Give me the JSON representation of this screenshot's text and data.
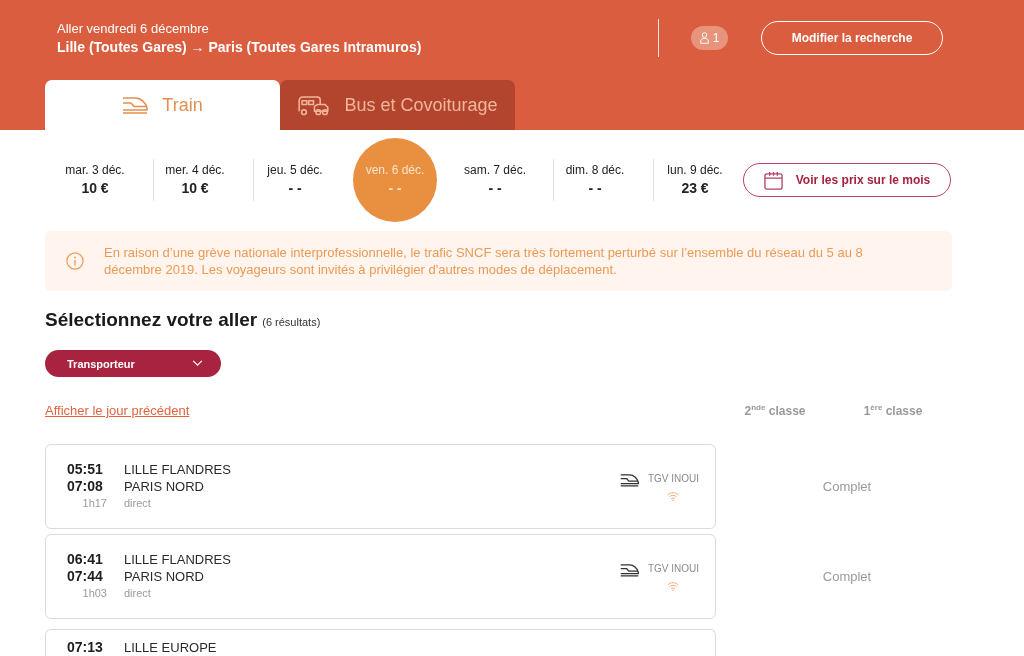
{
  "header": {
    "subtitle": "Aller vendredi 6 décembre",
    "route": "Lille (Toutes Gares) → Paris (Toutes Gares Intramuros)",
    "passengers": "1",
    "modify_button": "Modifier la recherche"
  },
  "tabs": [
    {
      "kind": "train",
      "label": "Train",
      "selected": true
    },
    {
      "kind": "bus",
      "label": "Bus et Covoiturage",
      "selected": false
    }
  ],
  "dates": [
    {
      "label": "mar. 3 déc.",
      "price": "10 €",
      "selected": false
    },
    {
      "label": "mer. 4 déc.",
      "price": "10 €",
      "selected": false
    },
    {
      "label": "jeu. 5 déc.",
      "price": "- -",
      "selected": false
    },
    {
      "label": "ven. 6 déc.",
      "price": "- -",
      "selected": true
    },
    {
      "label": "sam. 7 déc.",
      "price": "- -",
      "selected": false
    },
    {
      "label": "dim. 8 déc.",
      "price": "- -",
      "selected": false
    },
    {
      "label": "lun. 9 déc.",
      "price": "23 €",
      "selected": false
    }
  ],
  "month_prices_button": "Voir les prix sur le mois",
  "alert": {
    "text": "En raison d’une grève nationale interprofessionnelle, le trafic SNCF sera très fortement perturbé sur l’ensemble du réseau du 5 au 8 décembre 2019. Les voyageurs sont invités à privilégier d'autres modes de déplacement."
  },
  "results": {
    "title": "Sélectionnez votre aller",
    "count": "(6 résultats)",
    "filter": "Transporteur",
    "previous_day_link": "Afficher le jour précédent",
    "columns": [
      "2$^{nde}$ classe",
      "1$^{ère}$ classe"
    ],
    "rows": [
      {
        "departure": "05:51",
        "arrival": "07:08",
        "duration": "1h17",
        "origin": "LILLE FLANDRES",
        "destination": "PARIS NORD",
        "connection": "direct",
        "operator": "TGV INOUI",
        "wifi": true,
        "fare": "Complet"
      },
      {
        "departure": "06:41",
        "arrival": "07:44",
        "duration": "1h03",
        "origin": "LILLE FLANDRES",
        "destination": "PARIS NORD",
        "connection": "direct",
        "operator": "TGV INOUI",
        "wifi": true,
        "fare": "Complet"
      },
      {
        "departure": "07:13",
        "origin": "LILLE EUROPE"
      }
    ]
  }
}
